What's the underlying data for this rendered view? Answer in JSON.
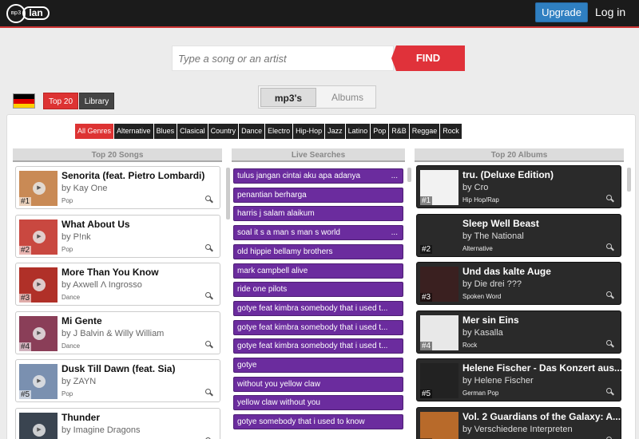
{
  "header": {
    "logo_left": "mp3",
    "logo_right": "lan",
    "upgrade_label": "Upgrade",
    "login_label": "Log in"
  },
  "search": {
    "placeholder": "Type a song or an artist",
    "find_label": "FIND"
  },
  "country_flag": "germany",
  "toggles": {
    "top20": "Top 20",
    "library": "Library"
  },
  "tabs": {
    "mp3": "mp3's",
    "albums": "Albums"
  },
  "genres": [
    {
      "label": "All Genres",
      "active": true
    },
    {
      "label": "Alternative"
    },
    {
      "label": "Blues"
    },
    {
      "label": "Clasical"
    },
    {
      "label": "Country"
    },
    {
      "label": "Dance"
    },
    {
      "label": "Electro"
    },
    {
      "label": "Hip-Hop"
    },
    {
      "label": "Jazz"
    },
    {
      "label": "Latino"
    },
    {
      "label": "Pop"
    },
    {
      "label": "R&B"
    },
    {
      "label": "Reggae"
    },
    {
      "label": "Rock"
    }
  ],
  "columns": {
    "songs": "Top 20 Songs",
    "live": "Live Searches",
    "albums": "Top 20 Albums"
  },
  "songs": [
    {
      "rank": "#1",
      "title": "Senorita (feat. Pietro Lombardi)",
      "artist": "by Kay One",
      "genre": "Pop",
      "cover": "#c98a55"
    },
    {
      "rank": "#2",
      "title": "What About Us",
      "artist": "by P!nk",
      "genre": "Pop",
      "cover": "#c94840"
    },
    {
      "rank": "#3",
      "title": "More Than You Know",
      "artist": "by Axwell Λ Ingrosso",
      "genre": "Dance",
      "cover": "#b03028"
    },
    {
      "rank": "#4",
      "title": "Mi Gente",
      "artist": "by J Balvin & Willy William",
      "genre": "Dance",
      "cover": "#8a3e58"
    },
    {
      "rank": "#5",
      "title": "Dusk Till Dawn (feat. Sia)",
      "artist": "by ZAYN",
      "genre": "Pop",
      "cover": "#7a90b0"
    },
    {
      "rank": "#6",
      "title": "Thunder",
      "artist": "by Imagine Dragons",
      "genre": "",
      "cover": "#3a4450"
    }
  ],
  "live_searches": [
    {
      "text": "tulus jangan cintai aku apa adanya",
      "more": "..."
    },
    {
      "text": "penantian berharga",
      "more": ""
    },
    {
      "text": "harris j salam alaikum",
      "more": ""
    },
    {
      "text": "soal it s a man s man s world",
      "more": "..."
    },
    {
      "text": "old hippie bellamy brothers",
      "more": ""
    },
    {
      "text": "mark campbell alive",
      "more": ""
    },
    {
      "text": "ride one pilots",
      "more": ""
    },
    {
      "text": "gotye feat kimbra somebody that i used t...",
      "more": ""
    },
    {
      "text": "gotye feat kimbra somebody that i used t...",
      "more": ""
    },
    {
      "text": "gotye feat kimbra somebody that i used t...",
      "more": ""
    },
    {
      "text": "gotye",
      "more": ""
    },
    {
      "text": "without you yellow claw",
      "more": ""
    },
    {
      "text": "yellow claw without you",
      "more": ""
    },
    {
      "text": "gotye somebody that i used to know",
      "more": ""
    }
  ],
  "albums": [
    {
      "rank": "#1",
      "title": "tru. (Deluxe Edition)",
      "artist": "by Cro",
      "genre": "Hip Hop/Rap",
      "cover": "#f2f2f2"
    },
    {
      "rank": "#2",
      "title": "Sleep Well Beast",
      "artist": "by The National",
      "genre": "Alternative",
      "cover": "#2a2a2a"
    },
    {
      "rank": "#3",
      "title": "Und das kalte Auge",
      "artist": "by Die drei ???",
      "genre": "Spoken Word",
      "cover": "#3a2020"
    },
    {
      "rank": "#4",
      "title": "Mer sin Eins",
      "artist": "by Kasalla",
      "genre": "Rock",
      "cover": "#e8e8e8"
    },
    {
      "rank": "#5",
      "title": "Helene Fischer - Das Konzert aus...",
      "artist": "by Helene Fischer",
      "genre": "German Pop",
      "cover": "#222222"
    },
    {
      "rank": "#6",
      "title": "Vol. 2 Guardians of the Galaxy: A...",
      "artist": "by Verschiedene Interpreten",
      "genre": "",
      "cover": "#b86a2a"
    }
  ]
}
